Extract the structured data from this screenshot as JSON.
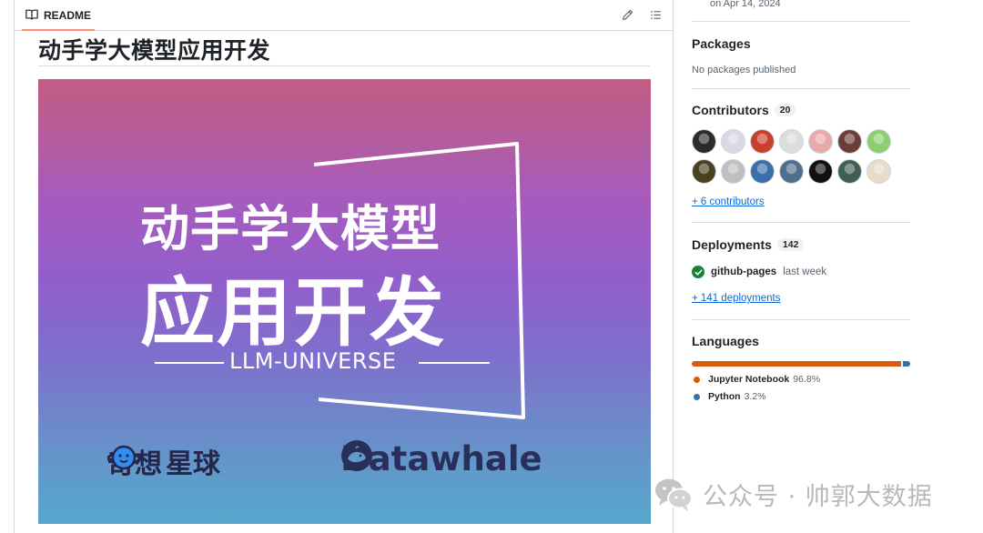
{
  "readme": {
    "tab_label": "README",
    "title": "动手学大模型应用开发",
    "banner": {
      "line1": "动手学大模型",
      "line2": "应用开发",
      "subtitle": "LLM-UNIVERSE",
      "logo_left": "奇想",
      "logo_left_suffix": "星球",
      "logo_right": "Datawhale"
    }
  },
  "sidebar": {
    "release_date": "on Apr 14, 2024",
    "packages": {
      "heading": "Packages",
      "empty_text": "No packages published"
    },
    "contributors": {
      "heading": "Contributors",
      "count": "20",
      "more_link": "+ 6 contributors",
      "avatar_colors": [
        "#2b2b2b",
        "#d9d9e6",
        "#c8402c",
        "#dcdcdc",
        "#e9a9a9",
        "#6b3f38",
        "#8ccf6f",
        "#4a4020",
        "#bfbfbf",
        "#3a6fa8",
        "#4f6f8f",
        "#111111",
        "#3f5f50",
        "#e8dcc8"
      ]
    },
    "deployments": {
      "heading": "Deployments",
      "count": "142",
      "env_name": "github-pages",
      "env_time": "last week",
      "more_link": "+ 141 deployments"
    },
    "languages": {
      "heading": "Languages",
      "items": [
        {
          "name": "Jupyter Notebook",
          "percent": "96.8%",
          "value": 96.8,
          "color": "#DA5B0B"
        },
        {
          "name": "Python",
          "percent": "3.2%",
          "value": 3.2,
          "color": "#3572A5"
        }
      ]
    }
  },
  "watermark": {
    "text": "公众号 · 帅郭大数据"
  }
}
